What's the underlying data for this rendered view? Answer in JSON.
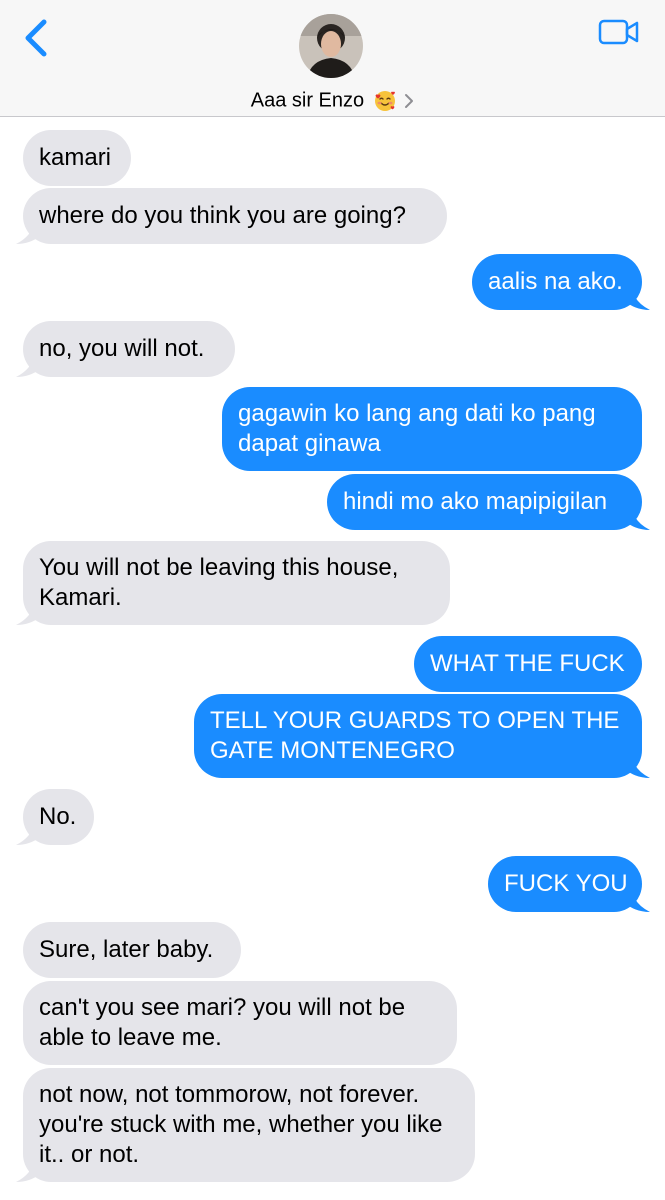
{
  "header": {
    "contact_name": "Aaa sir Enzo",
    "contact_emoji": "smiling-face-with-hearts",
    "back_icon": "chevron-left-icon",
    "video_icon": "video-camera-icon",
    "accent_color": "#1a8cff"
  },
  "messages": [
    {
      "sender": "them",
      "text": "kamari"
    },
    {
      "sender": "them",
      "text": "where do you think you are going?"
    },
    {
      "sender": "me",
      "text": "aalis na ako."
    },
    {
      "sender": "them",
      "text": "no, you will not."
    },
    {
      "sender": "me",
      "text": "gagawin ko lang ang dati ko pang dapat ginawa"
    },
    {
      "sender": "me",
      "text": "hindi mo ako mapipigilan"
    },
    {
      "sender": "them",
      "text": "You will not be leaving this house, Kamari."
    },
    {
      "sender": "me",
      "text": "WHAT THE FUCK"
    },
    {
      "sender": "me",
      "text": "TELL YOUR GUARDS TO OPEN THE GATE MONTENEGRO"
    },
    {
      "sender": "them",
      "text": "No."
    },
    {
      "sender": "me",
      "text": "FUCK YOU"
    },
    {
      "sender": "them",
      "text": "Sure, later baby."
    },
    {
      "sender": "them",
      "text": "can't you see mari? you will not be able to leave me."
    },
    {
      "sender": "them",
      "text": "not now, not tommorow, not forever. you're stuck with me, whether you like it.. or not."
    }
  ]
}
